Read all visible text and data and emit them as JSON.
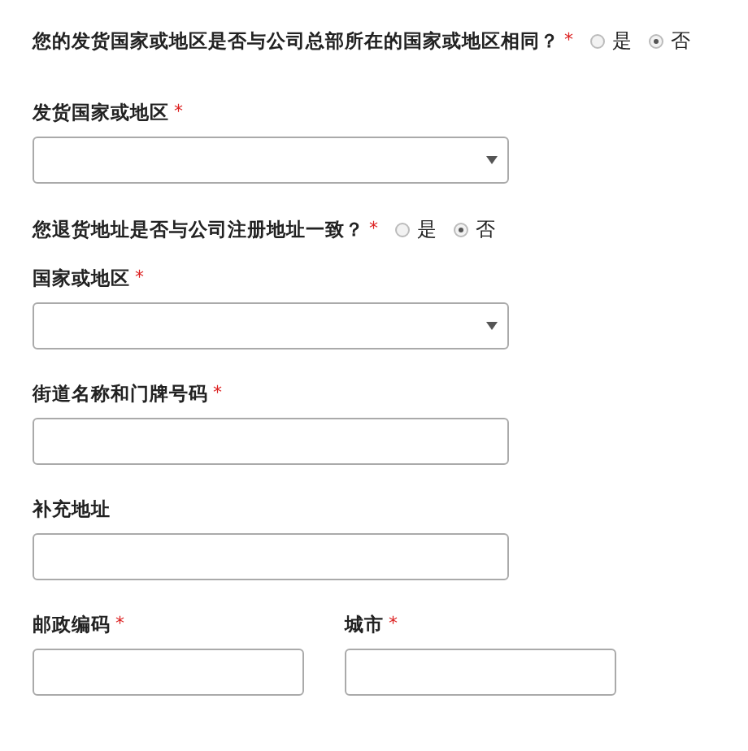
{
  "fields": [
    {
      "kind": "question",
      "label": "您的发货国家或地区是否与公司总部所在的国家或地区相同？",
      "mark": "*",
      "options": [
        {
          "label": "是",
          "selected": false
        },
        {
          "label": "否",
          "selected": true
        }
      ]
    },
    {
      "kind": "select",
      "label": "发货国家或地区",
      "mark": "*"
    },
    {
      "kind": "question",
      "label": "您退货地址是否与公司注册地址一致？",
      "mark": "*",
      "options": [
        {
          "label": "是",
          "selected": false
        },
        {
          "label": "否",
          "selected": true
        }
      ]
    },
    {
      "kind": "select",
      "label": "国家或地区",
      "mark": "*"
    },
    {
      "kind": "text",
      "label": "街道名称和门牌号码",
      "mark": "*"
    },
    {
      "kind": "text",
      "label": "补充地址"
    },
    {
      "kind": "pair",
      "fields": [
        {
          "kind": "text",
          "label": "邮政编码",
          "mark": "*"
        },
        {
          "kind": "text",
          "label": "城市",
          "mark": "*"
        }
      ]
    }
  ]
}
